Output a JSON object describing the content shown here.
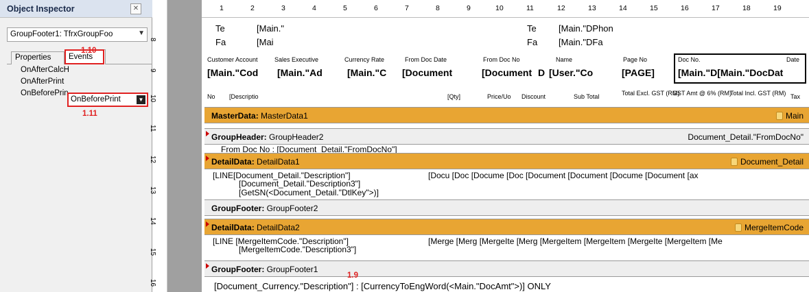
{
  "inspector": {
    "title": "Object Inspector",
    "combo_value": "GroupFooter1: TfrxGroupFoo",
    "tab_properties": "Properties",
    "tab_events": "Events",
    "events": [
      "OnAfterCalcH",
      "OnAfterPrint",
      "OnBeforePrin"
    ],
    "selected_value": "OnBeforePrint",
    "annotations": [
      "1.10",
      "1.11"
    ]
  },
  "ruler": {
    "h": [
      "1",
      "2",
      "3",
      "4",
      "5",
      "6",
      "7",
      "8",
      "9",
      "10",
      "11",
      "12",
      "13",
      "14",
      "15",
      "16",
      "17",
      "18",
      "19"
    ],
    "v": [
      "8",
      "9",
      "10",
      "11",
      "12",
      "13",
      "14",
      "15",
      "16"
    ]
  },
  "page_header": {
    "r1": [
      "Te",
      "[Main.\"",
      "Te",
      "[Main.\"DPhon"
    ],
    "r2": [
      "Fa",
      "[Mai",
      "Fa",
      "[Main.\"DFa"
    ],
    "labels": [
      "Customer Account",
      "Sales Executive",
      "Currency Rate",
      "From Doc Date",
      "From Doc No",
      "Name",
      "Page No",
      "Doc No.",
      "Date"
    ],
    "values": [
      "[Main.\"Cod",
      "[Main.\"Ad",
      "[Main.\"C",
      "[Document",
      "[Document",
      "D",
      "[User.\"Co",
      "[PAGE]",
      "[Main.\"D[Main.\"DocDat"
    ],
    "cols": [
      "No",
      "[Descriptio",
      "[Qty]",
      "Price/Uo",
      "Discount",
      "Sub Total",
      "Total Excl. GST (RM)",
      "GST Amt @ 6% (RM)",
      "Total Incl. GST (RM)",
      "Tax"
    ]
  },
  "bands": {
    "master": {
      "type": "MasterData:",
      "name": "MasterData1",
      "right": "Main"
    },
    "gh": {
      "type": "GroupHeader:",
      "name": "GroupHeader2",
      "right": "Document_Detail.\"FromDocNo\"",
      "content": "From Doc No : [Document_Detail.\"FromDocNo\"]"
    },
    "dd1": {
      "type": "DetailData:",
      "name": "DetailData1",
      "right": "Document_Detail",
      "lines": [
        "[LINE[Document_Detail.\"Description\"]",
        "[Document_Detail.\"Description3\"]",
        "[GetSN(<Document_Detail.\"DtlKey\">)]"
      ],
      "tail": "[Docu [Doc [Docume [Doc [Document [Document [Docume [Document [ax"
    },
    "gf2": {
      "type": "GroupFooter:",
      "name": "GroupFooter2"
    },
    "dd2": {
      "type": "DetailData:",
      "name": "DetailData2",
      "right": "MergeItemCode",
      "lines": [
        "[LINE [MergeItemCode.\"Description\"]",
        "[MergeItemCode.\"Description3\"]"
      ],
      "tail": "[Merge [Merg [MergeIte [Merg [MergeItem [MergeItem [MergeIte [MergeItem [Me"
    },
    "gf1": {
      "type": "GroupFooter:",
      "name": "GroupFooter1",
      "annotation": "1.9",
      "content": "[Document_Currency.\"Description\"] : [CurrencyToEngWord(<Main.\"DocAmt\">)] ONLY"
    }
  }
}
